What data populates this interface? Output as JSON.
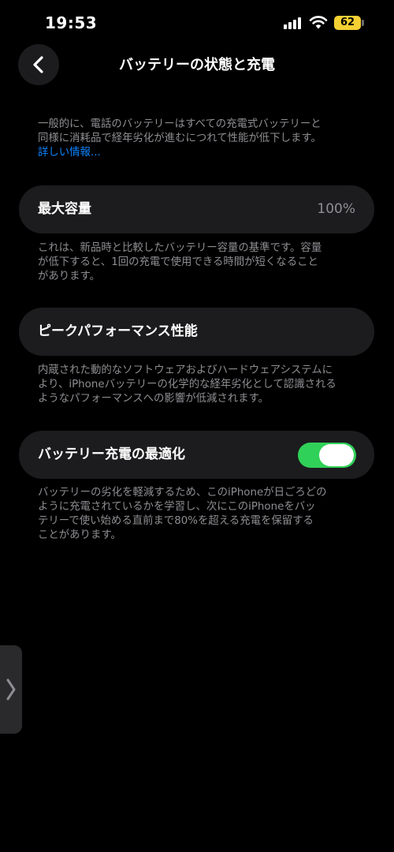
{
  "status_bar": {
    "time": "19:53",
    "battery_level": "62",
    "battery_color": "#f5d033"
  },
  "nav": {
    "back_icon": "chevron-left-icon",
    "title": "バッテリーの状態と充電"
  },
  "intro": {
    "line1": "一般的に、電話のバッテリーはすべての充電式バッテリーと",
    "line2": "同様に消耗品で経年劣化が進むにつれて性能が低下します。",
    "link": "詳しい情報..."
  },
  "max_capacity": {
    "label": "最大容量",
    "value": "100%",
    "desc_line1": "これは、新品時と比較したバッテリー容量の基準です。容量",
    "desc_line2": "が低下すると、1回の充電で使用できる時間が短くなること",
    "desc_line3": "があります。"
  },
  "peak_performance": {
    "label": "ピークパフォーマンス性能",
    "desc_line1": "内蔵された動的なソフトウェアおよびハードウェアシステムに",
    "desc_line2": "より、iPhoneバッテリーの化学的な経年劣化として認識される",
    "desc_line3": "ようなパフォーマンスへの影響が低減されます。"
  },
  "optimized_charging": {
    "label": "バッテリー充電の最適化",
    "enabled": true,
    "toggle_color": "#30d158",
    "desc_line1": "バッテリーの劣化を軽減するため、このiPhoneが日ごろどの",
    "desc_line2": "ように充電されているかを学習し、次にこのiPhoneをバッ",
    "desc_line3": "テリーで使い始める直前まで80%を超える充電を保留する",
    "desc_line4": "ことがあります。"
  },
  "side_handle": {
    "icon": "chevron-right-icon"
  }
}
